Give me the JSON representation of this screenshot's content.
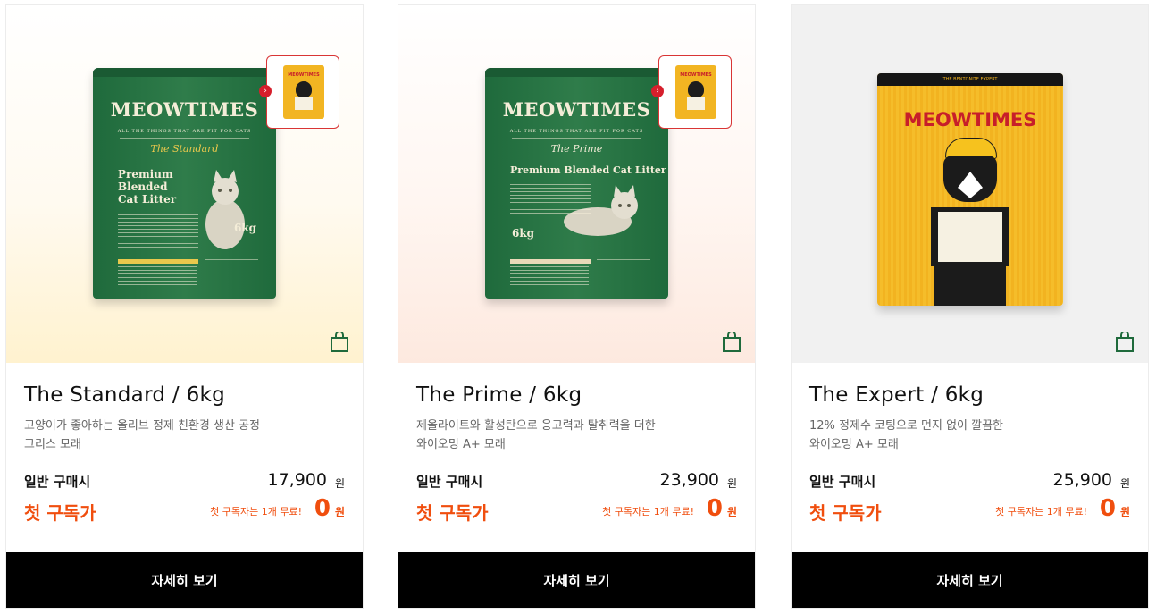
{
  "products": [
    {
      "title": "The Standard / 6kg",
      "desc_line1": "고양이가 좋아하는 올리브 정제 친환경 생산 공정",
      "desc_line2": "그리스 모래",
      "price_label": "일반 구매시",
      "price": "17,900",
      "price_unit": "원",
      "sub_label": "첫 구독가",
      "sub_note": "첫 구독자는 1개 무료!",
      "sub_price": "0",
      "sub_unit": "원",
      "button": "자세히 보기",
      "bag": {
        "brand": "MEOWTIMES",
        "tagline": "ALL THE THINGS THAT ARE FIT FOR CATS",
        "edition": "The Standard",
        "headline_1": "Premium",
        "headline_2": "Blended",
        "headline_3": "Cat Litter",
        "weight": "6kg"
      },
      "thumb_brand": "MEOWTIMES"
    },
    {
      "title": "The Prime / 6kg",
      "desc_line1": "제올라이트와 활성탄으로 응고력과 탈취력을 더한",
      "desc_line2": "와이오밍 A+ 모래",
      "price_label": "일반 구매시",
      "price": "23,900",
      "price_unit": "원",
      "sub_label": "첫 구독가",
      "sub_note": "첫 구독자는 1개 무료!",
      "sub_price": "0",
      "sub_unit": "원",
      "button": "자세히 보기",
      "bag": {
        "brand": "MEOWTIMES",
        "tagline": "ALL THE THINGS THAT ARE FIT FOR CATS",
        "edition": "The Prime",
        "headline_1": "Premium Blended Cat Litter",
        "weight": "6kg"
      },
      "thumb_brand": "MEOWTIMES"
    },
    {
      "title": "The Expert / 6kg",
      "desc_line1": "12% 정제수 코팅으로 먼지 없이 깔끔한",
      "desc_line2": "와이오밍 A+ 모래",
      "price_label": "일반 구매시",
      "price": "25,900",
      "price_unit": "원",
      "sub_label": "첫 구독가",
      "sub_note": "첫 구독자는 1개 무료!",
      "sub_price": "0",
      "sub_unit": "원",
      "button": "자세히 보기",
      "bag": {
        "brand": "MEOWTIMES",
        "band": "THE BENTONITE EXPERT"
      }
    }
  ],
  "colors": {
    "accent": "#f04e0e",
    "button_bg": "#000000",
    "cart_icon": "#1f6a3c",
    "thumb_border": "#d93535"
  },
  "icons": {
    "cart": "shopping-bag-icon",
    "thumb_arrow": "chevron-right-icon"
  }
}
